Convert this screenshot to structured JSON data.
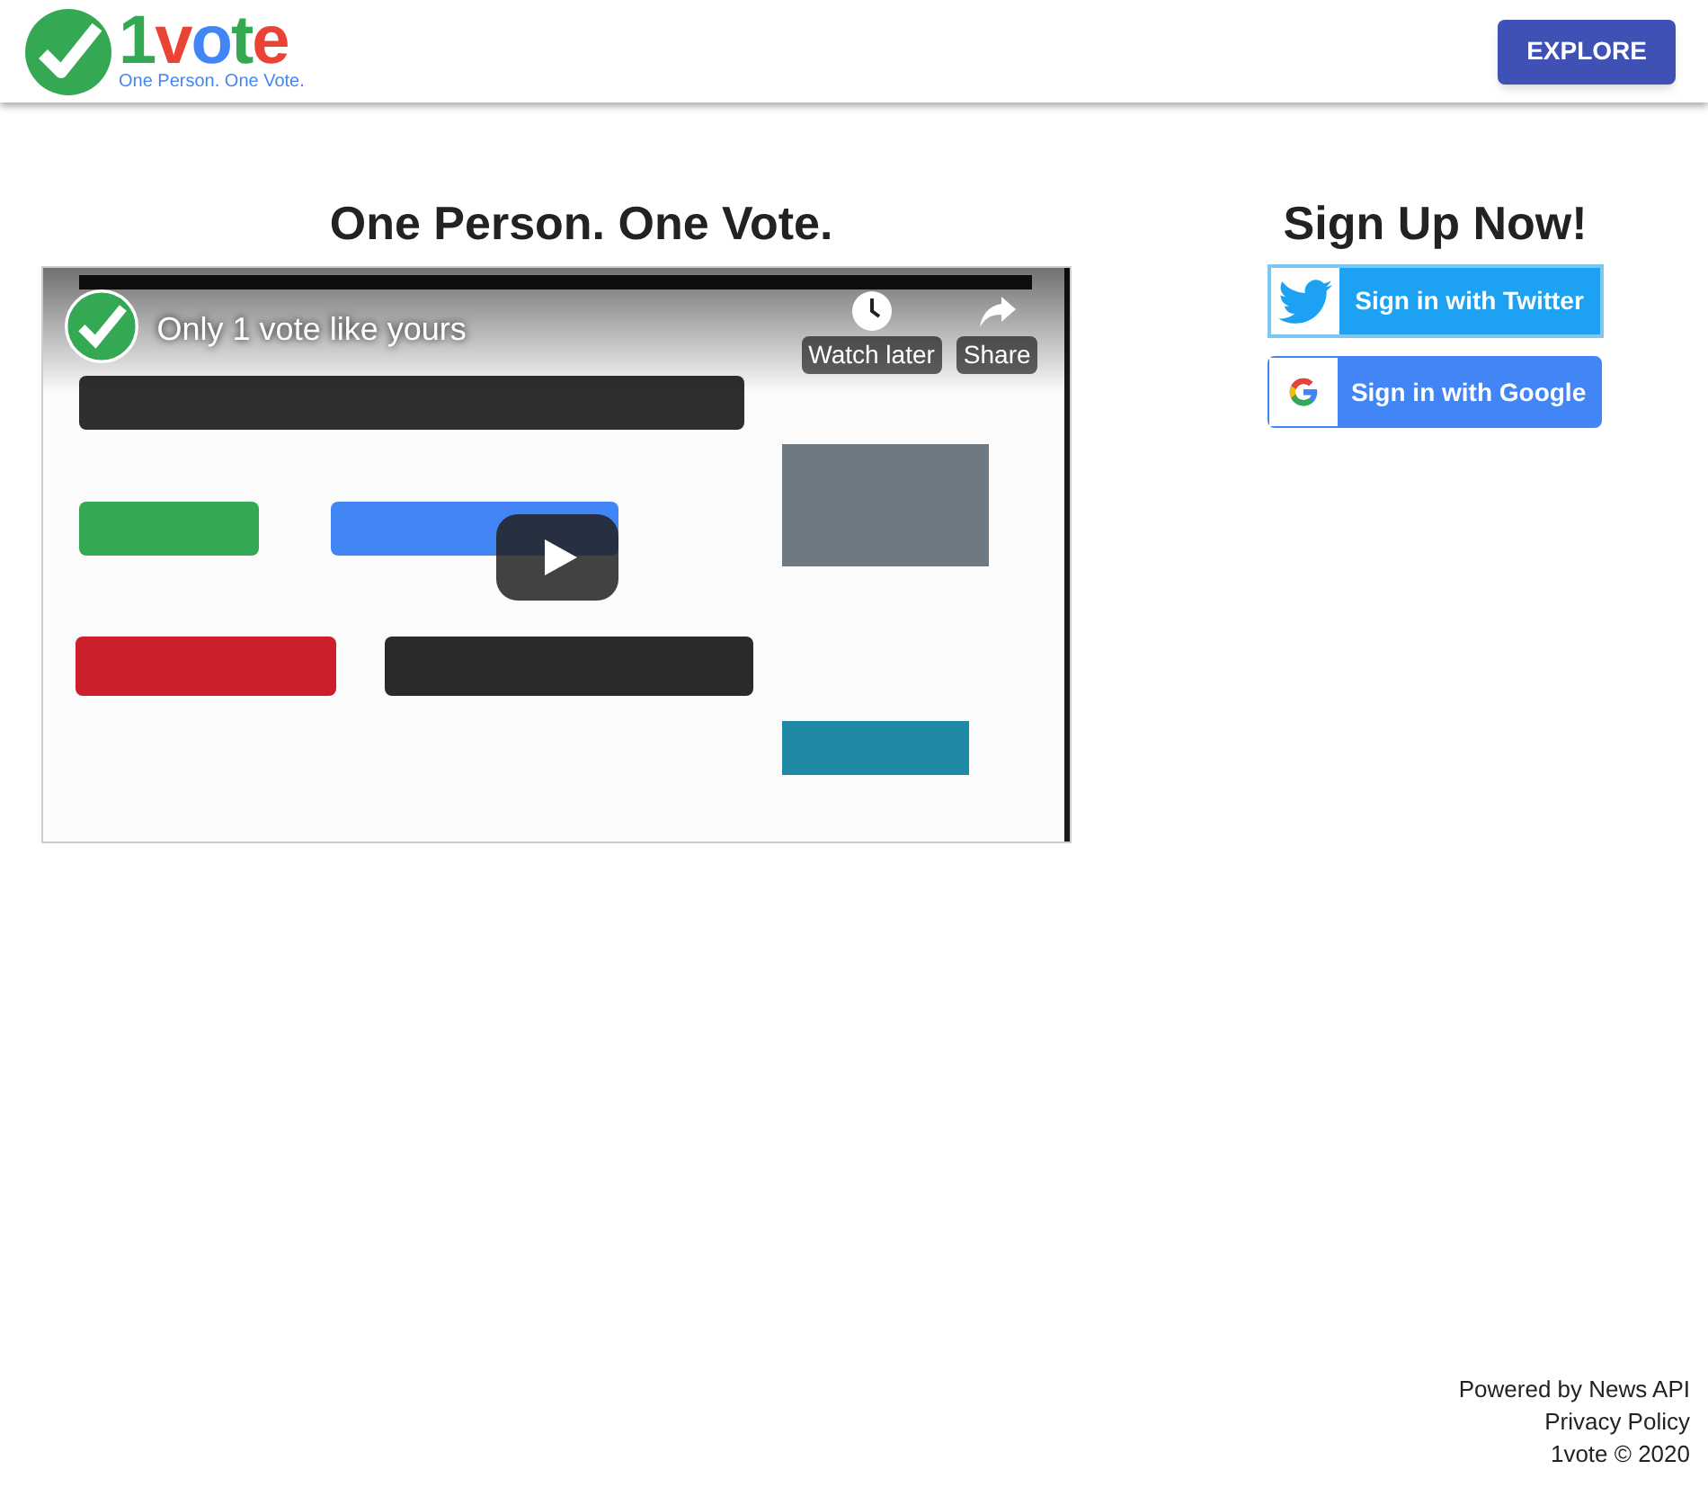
{
  "header": {
    "logo": {
      "letters": [
        {
          "text": "1",
          "color": "#34a853"
        },
        {
          "text": "v",
          "color": "#ea4335"
        },
        {
          "text": "o",
          "color": "#4285f4"
        },
        {
          "text": "t",
          "color": "#34a853"
        },
        {
          "text": "e",
          "color": "#ea4335"
        }
      ],
      "tagline": "One Person. One Vote."
    },
    "explore_button": "EXPLORE"
  },
  "main": {
    "heading": "One Person. One Vote.",
    "video": {
      "title": "Only 1 vote like yours",
      "actions": [
        "Watch later",
        "Share"
      ]
    }
  },
  "signup": {
    "heading": "Sign Up Now!",
    "buttons": [
      {
        "kind": "twitter",
        "label": "Sign in with Twitter"
      },
      {
        "kind": "google",
        "label": "Sign in with Google"
      }
    ]
  },
  "footer": [
    "Powered by News API",
    "Privacy Policy",
    "1vote © 2020"
  ]
}
